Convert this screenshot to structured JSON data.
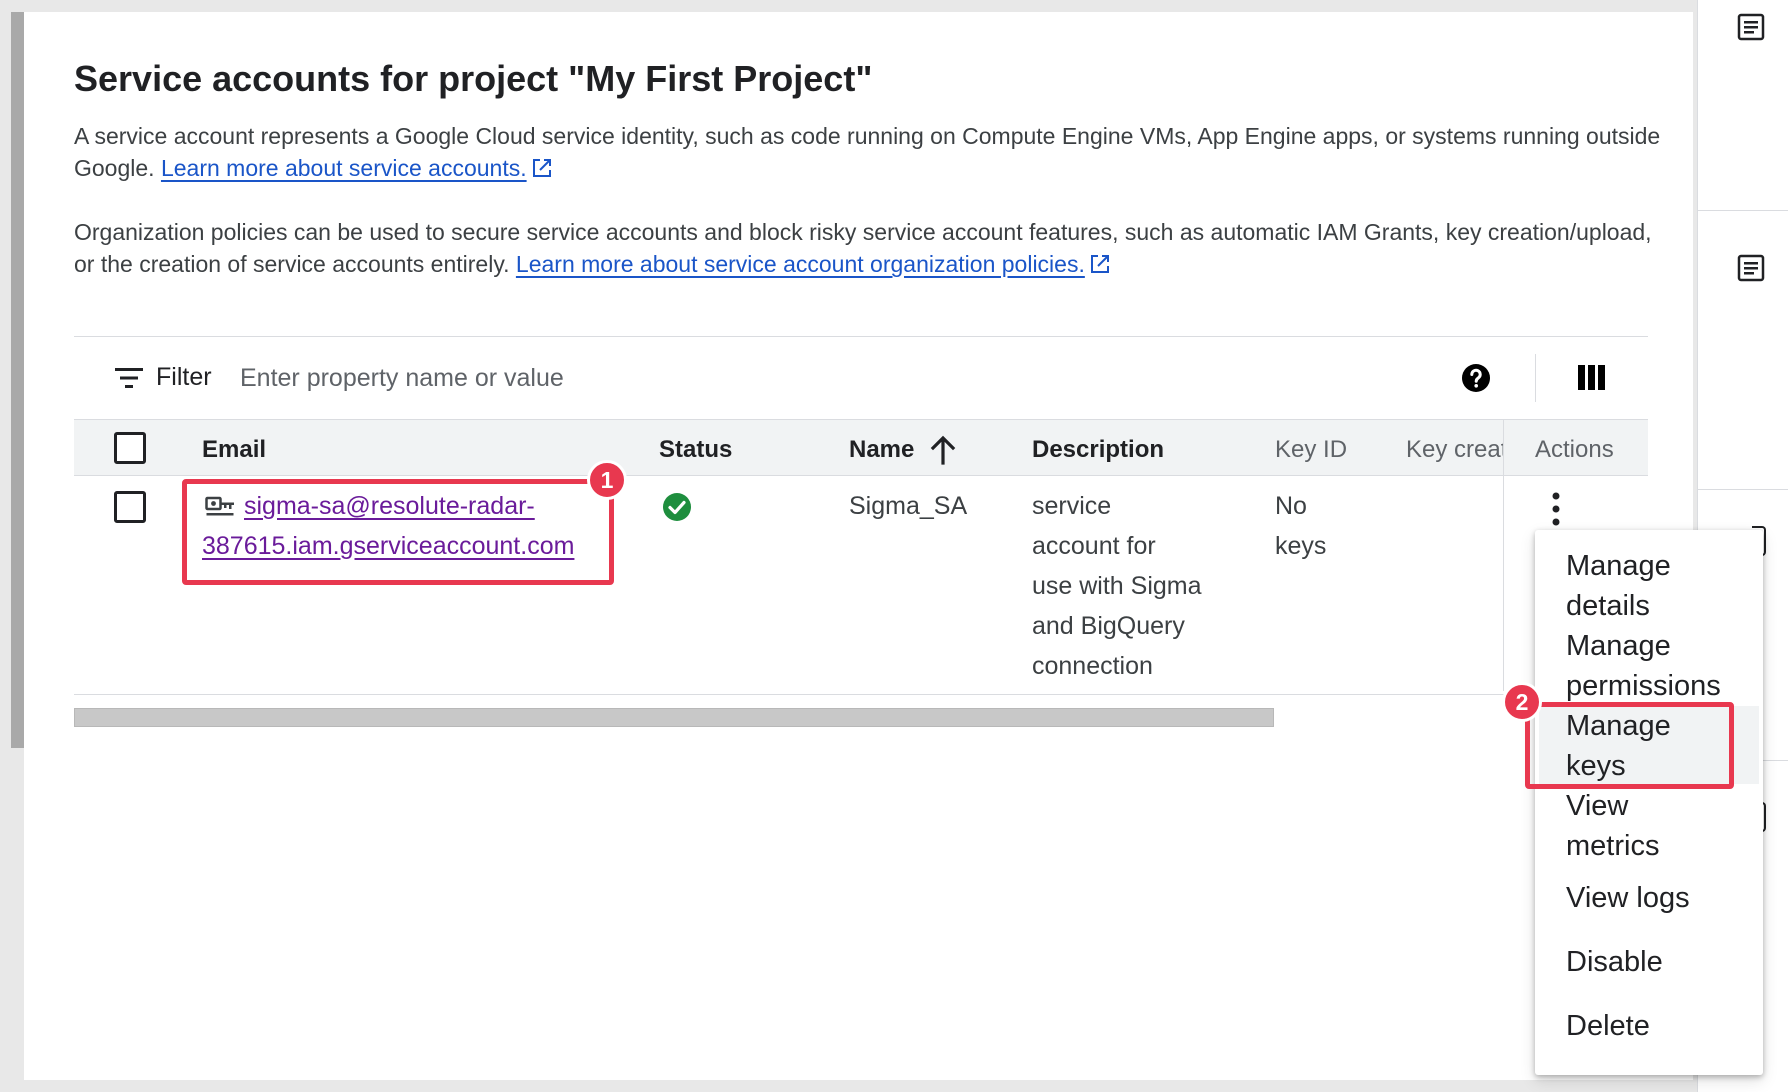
{
  "page": {
    "title": "Service accounts for project \"My First Project\"",
    "intro_text": "A service account represents a Google Cloud service identity, such as code running on Compute Engine VMs, App Engine apps, or systems running outside Google. ",
    "intro_link": "Learn more about service accounts.",
    "policy_text": "Organization policies can be used to secure service accounts and block risky service account features, such as automatic IAM Grants, key creation/upload, or the creation of service accounts entirely. ",
    "policy_link": "Learn more about service account organization policies."
  },
  "filter": {
    "label": "Filter",
    "placeholder": "Enter property name or value"
  },
  "table": {
    "columns": {
      "email": "Email",
      "status": "Status",
      "name": "Name",
      "description": "Description",
      "key_id": "Key ID",
      "key_created": "Key creat",
      "actions": "Actions"
    },
    "rows": [
      {
        "email_line1": "sigma-sa@resolute-radar-",
        "email_line2": "387615.iam.gserviceaccount.com",
        "name": "Sigma_SA",
        "description_lines": [
          "service",
          "account for",
          "use with Sigma",
          "and BigQuery",
          "connection"
        ],
        "key_id_lines": [
          "No",
          "keys"
        ]
      }
    ]
  },
  "menu": {
    "items": [
      [
        "Manage",
        "details"
      ],
      [
        "Manage",
        "permissions"
      ],
      [
        "Manage",
        "keys"
      ],
      [
        "View",
        "metrics"
      ],
      [
        "View logs"
      ],
      [
        "Disable"
      ],
      [
        "Delete"
      ]
    ]
  },
  "annotations": {
    "badge1": "1",
    "badge2": "2"
  },
  "colors": {
    "callout": "#e8384f",
    "link": "#1a55c8",
    "email_link": "#6a1b9a",
    "status_ok": "#1e8e3e"
  },
  "icons": {
    "filter": "filter-list-icon",
    "help": "help-circle-icon",
    "columns": "view-columns-icon",
    "sort": "arrow-up-icon",
    "service_account": "service-account-key-icon",
    "status": "check-circle-icon",
    "kebab": "more-vert-icon",
    "external": "open-in-new-icon",
    "rail": "notes-icon"
  }
}
